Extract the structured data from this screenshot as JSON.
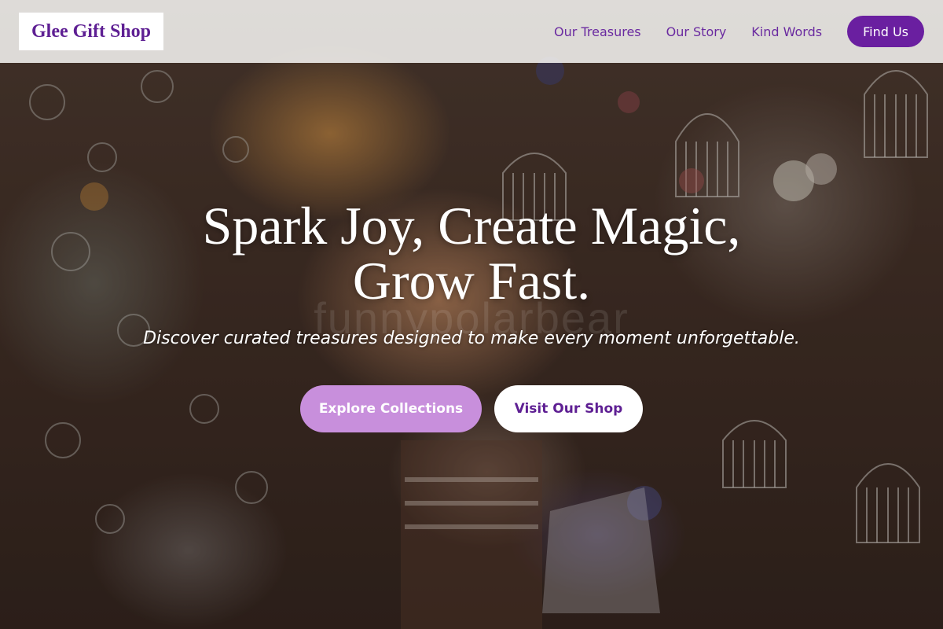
{
  "header": {
    "logo_text": "Glee Gift Shop",
    "nav": [
      {
        "label": "Our Treasures"
      },
      {
        "label": "Our Story"
      },
      {
        "label": "Kind Words"
      }
    ],
    "cta_label": "Find Us"
  },
  "hero": {
    "title_line1": "Spark Joy, Create Magic,",
    "title_line2": "Grow Fast.",
    "subtitle": "Discover curated treasures designed to make every moment unforgettable.",
    "primary_button": "Explore Collections",
    "secondary_button": "Visit Our Shop",
    "watermark_text": "funnypolarbear"
  },
  "colors": {
    "brand_purple": "#6a1fa0",
    "logo_text": "#5e1f93",
    "primary_button_bg": "#c88fdc",
    "secondary_button_bg": "#ffffff",
    "header_bg": "#f4f2f0"
  }
}
